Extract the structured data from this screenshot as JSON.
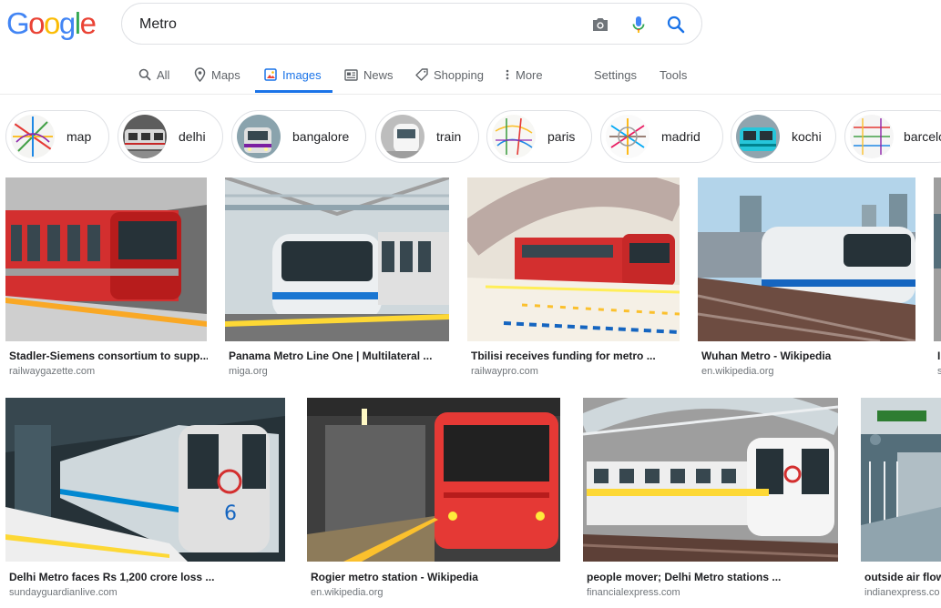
{
  "logo": [
    "G",
    "o",
    "o",
    "g",
    "l",
    "e"
  ],
  "search": {
    "query": "Metro"
  },
  "icons": {
    "camera": "camera-icon",
    "mic": "microphone-icon",
    "search": "search-icon"
  },
  "nav": {
    "all": "All",
    "maps": "Maps",
    "images": "Images",
    "news": "News",
    "shopping": "Shopping",
    "more": "More",
    "settings": "Settings",
    "tools": "Tools"
  },
  "chips": [
    {
      "label": "map"
    },
    {
      "label": "delhi"
    },
    {
      "label": "bangalore"
    },
    {
      "label": "train"
    },
    {
      "label": "paris"
    },
    {
      "label": "madrid"
    },
    {
      "label": "kochi"
    },
    {
      "label": "barcelo"
    }
  ],
  "results": [
    {
      "title": "Stadler-Siemens consortium to supp...",
      "source": "railwaygazette.com"
    },
    {
      "title": "Panama Metro Line One | Multilateral ...",
      "source": "miga.org"
    },
    {
      "title": "Tbilisi receives funding for metro ...",
      "source": "railwaypro.com"
    },
    {
      "title": "Wuhan Metro - Wikipedia",
      "source": "en.wikipedia.org"
    },
    {
      "title": "I",
      "source": "s"
    },
    {
      "title": "Delhi Metro faces Rs 1,200 crore loss ...",
      "source": "sundayguardianlive.com"
    },
    {
      "title": "Rogier metro station - Wikipedia",
      "source": "en.wikipedia.org"
    },
    {
      "title": "people mover; Delhi Metro stations ...",
      "source": "financialexpress.com"
    },
    {
      "title": "outside air flow",
      "source": "indianexpress.co"
    }
  ],
  "colors": {
    "accent": "#1a73e8",
    "muted_text": "#5f6368",
    "source_text": "#70757a"
  }
}
